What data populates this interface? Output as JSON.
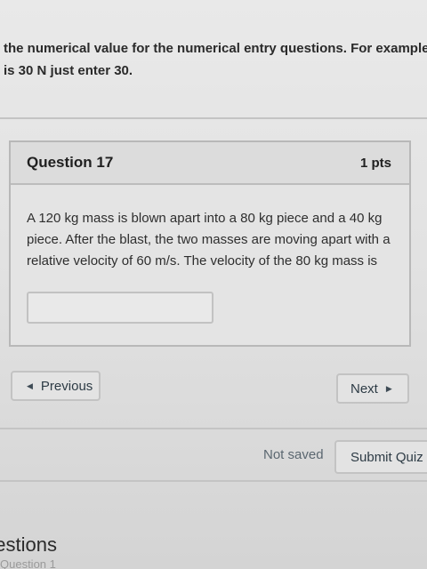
{
  "instructions": {
    "line1": "the numerical value for the numerical entry questions. For example if t",
    "line2": "is 30 N just enter 30."
  },
  "question": {
    "title": "Question 17",
    "points": "1 pts",
    "text": "A 120 kg mass is blown apart into a 80 kg piece and a 40 kg piece. After the blast, the two masses are moving apart with a relative velocity of 60 m/s. The velocity of the 80 kg mass is",
    "answer_value": "",
    "answer_placeholder": ""
  },
  "navigation": {
    "previous_label": "Previous",
    "next_label": "Next",
    "previous_icon": "triangle-left-icon",
    "next_icon": "triangle-right-icon"
  },
  "footer": {
    "status": "Not saved",
    "submit_label": "Submit Quiz"
  },
  "question_list": {
    "heading": "uestions",
    "link": "Question 1"
  }
}
